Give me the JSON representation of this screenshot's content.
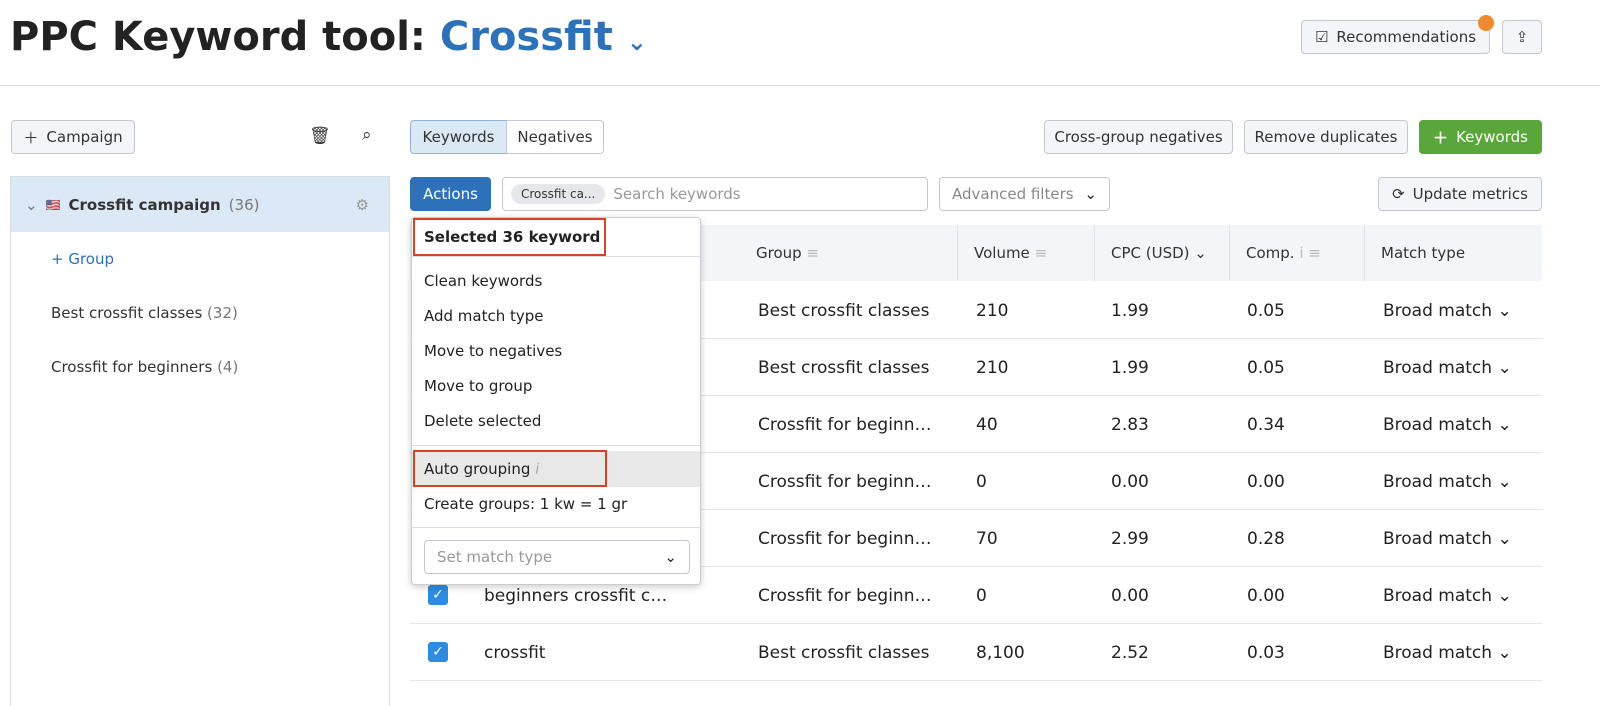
{
  "header": {
    "title": "PPC Keyword tool:",
    "project": "Crossfit",
    "recommendations": "Recommendations"
  },
  "sidebar": {
    "add_campaign": "Campaign",
    "campaign": {
      "name": "Crossfit campaign",
      "count": "(36)"
    },
    "add_group": "Group",
    "groups": [
      {
        "name": "Best crossfit classes",
        "count": "(32)"
      },
      {
        "name": "Crossfit for beginners",
        "count": "(4)"
      }
    ]
  },
  "toolbar": {
    "tabs": [
      "Keywords",
      "Negatives"
    ],
    "cross_group": "Cross-group negatives",
    "remove_duplicates": "Remove duplicates",
    "add_keywords": "Keywords",
    "actions": "Actions",
    "filter_chip": "Crossfit ca...",
    "search_placeholder": "Search keywords",
    "advanced_filters": "Advanced filters",
    "update_metrics": "Update metrics"
  },
  "table": {
    "headers": [
      "Group",
      "Volume",
      "CPC (USD)",
      "Comp.",
      "Match type"
    ],
    "rows": [
      {
        "keyword": "",
        "group": "Best crossfit classes",
        "volume": "210",
        "cpc": "1.99",
        "comp": "0.05",
        "match": "Broad match"
      },
      {
        "keyword": "",
        "group": "Best crossfit classes",
        "volume": "210",
        "cpc": "1.99",
        "comp": "0.05",
        "match": "Broad match"
      },
      {
        "keyword": "",
        "group": "Crossfit for beginn…",
        "volume": "40",
        "cpc": "2.83",
        "comp": "0.34",
        "match": "Broad match"
      },
      {
        "keyword": "",
        "group": "Crossfit for beginn…",
        "volume": "0",
        "cpc": "0.00",
        "comp": "0.00",
        "match": "Broad match"
      },
      {
        "keyword": "",
        "group": "Crossfit for beginn…",
        "volume": "70",
        "cpc": "2.99",
        "comp": "0.28",
        "match": "Broad match"
      },
      {
        "keyword": "beginners crossfit c…",
        "group": "Crossfit for beginn…",
        "volume": "0",
        "cpc": "0.00",
        "comp": "0.00",
        "match": "Broad match"
      },
      {
        "keyword": "crossfit",
        "group": "Best crossfit classes",
        "volume": "8,100",
        "cpc": "2.52",
        "comp": "0.03",
        "match": "Broad match"
      }
    ]
  },
  "menu": {
    "selected": "Selected 36 keyword",
    "items": [
      "Clean keywords",
      "Add match type",
      "Move to negatives",
      "Move to group",
      "Delete selected"
    ],
    "auto_grouping": "Auto grouping",
    "create_groups": "Create groups: 1 kw = 1 gr",
    "set_match_placeholder": "Set match type"
  },
  "colors": {
    "accent": "#2d72b8",
    "green": "#5aa63a",
    "highlight": "#d9402b",
    "badge": "#f08a30"
  }
}
